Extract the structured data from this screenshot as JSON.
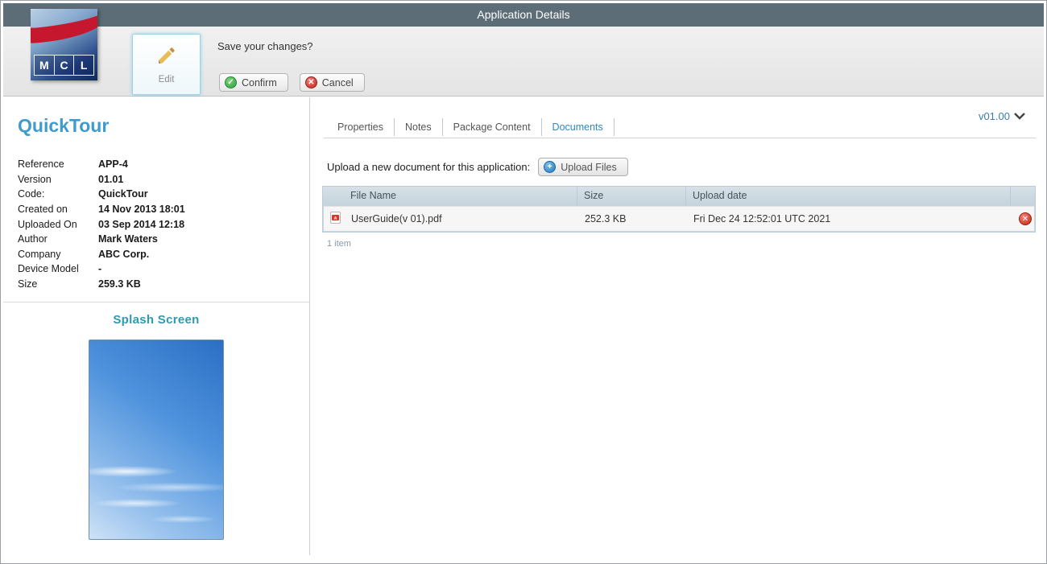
{
  "titlebar": {
    "title": "Application Details"
  },
  "toolbar": {
    "logo_letters": {
      "m": "M",
      "c": "C",
      "l": "L"
    },
    "edit_label": "Edit",
    "prompt": "Save your changes?",
    "confirm_label": "Confirm",
    "cancel_label": "Cancel"
  },
  "app": {
    "name": "QuickTour",
    "fields": [
      {
        "label": "Reference",
        "value": "APP-4"
      },
      {
        "label": "Version",
        "value": "01.01"
      },
      {
        "label": "Code:",
        "value": "QuickTour"
      },
      {
        "label": "Created on",
        "value": "14 Nov 2013 18:01"
      },
      {
        "label": "Uploaded On",
        "value": "03 Sep 2014 12:18"
      },
      {
        "label": "Author",
        "value": "Mark Waters"
      },
      {
        "label": "Company",
        "value": "ABC Corp."
      },
      {
        "label": "Device Model",
        "value": "-"
      },
      {
        "label": "Size",
        "value": "259.3 KB"
      }
    ],
    "splash_title": "Splash Screen"
  },
  "content": {
    "version": "v01.00",
    "tabs": [
      {
        "label": "Properties"
      },
      {
        "label": "Notes"
      },
      {
        "label": "Package Content"
      },
      {
        "label": "Documents"
      }
    ],
    "upload_prompt": "Upload a new document for this application:",
    "upload_button": "Upload Files",
    "table": {
      "headers": [
        "File Name",
        "Size",
        "Upload date"
      ],
      "rows": [
        {
          "file_name": "UserGuide(v 01).pdf",
          "size": "252.3 KB",
          "upload_date": "Fri Dec 24 12:52:01 UTC 2021"
        }
      ]
    },
    "footer": "1 item"
  },
  "colors": {
    "titlebar_bg": "#5d6d78",
    "accent_blue": "#3d9bcd",
    "active_tab": "#2f86c8",
    "table_header_bg": "#ccd8e0",
    "confirm_green": "#2e9e3a",
    "cancel_red": "#c22315"
  }
}
